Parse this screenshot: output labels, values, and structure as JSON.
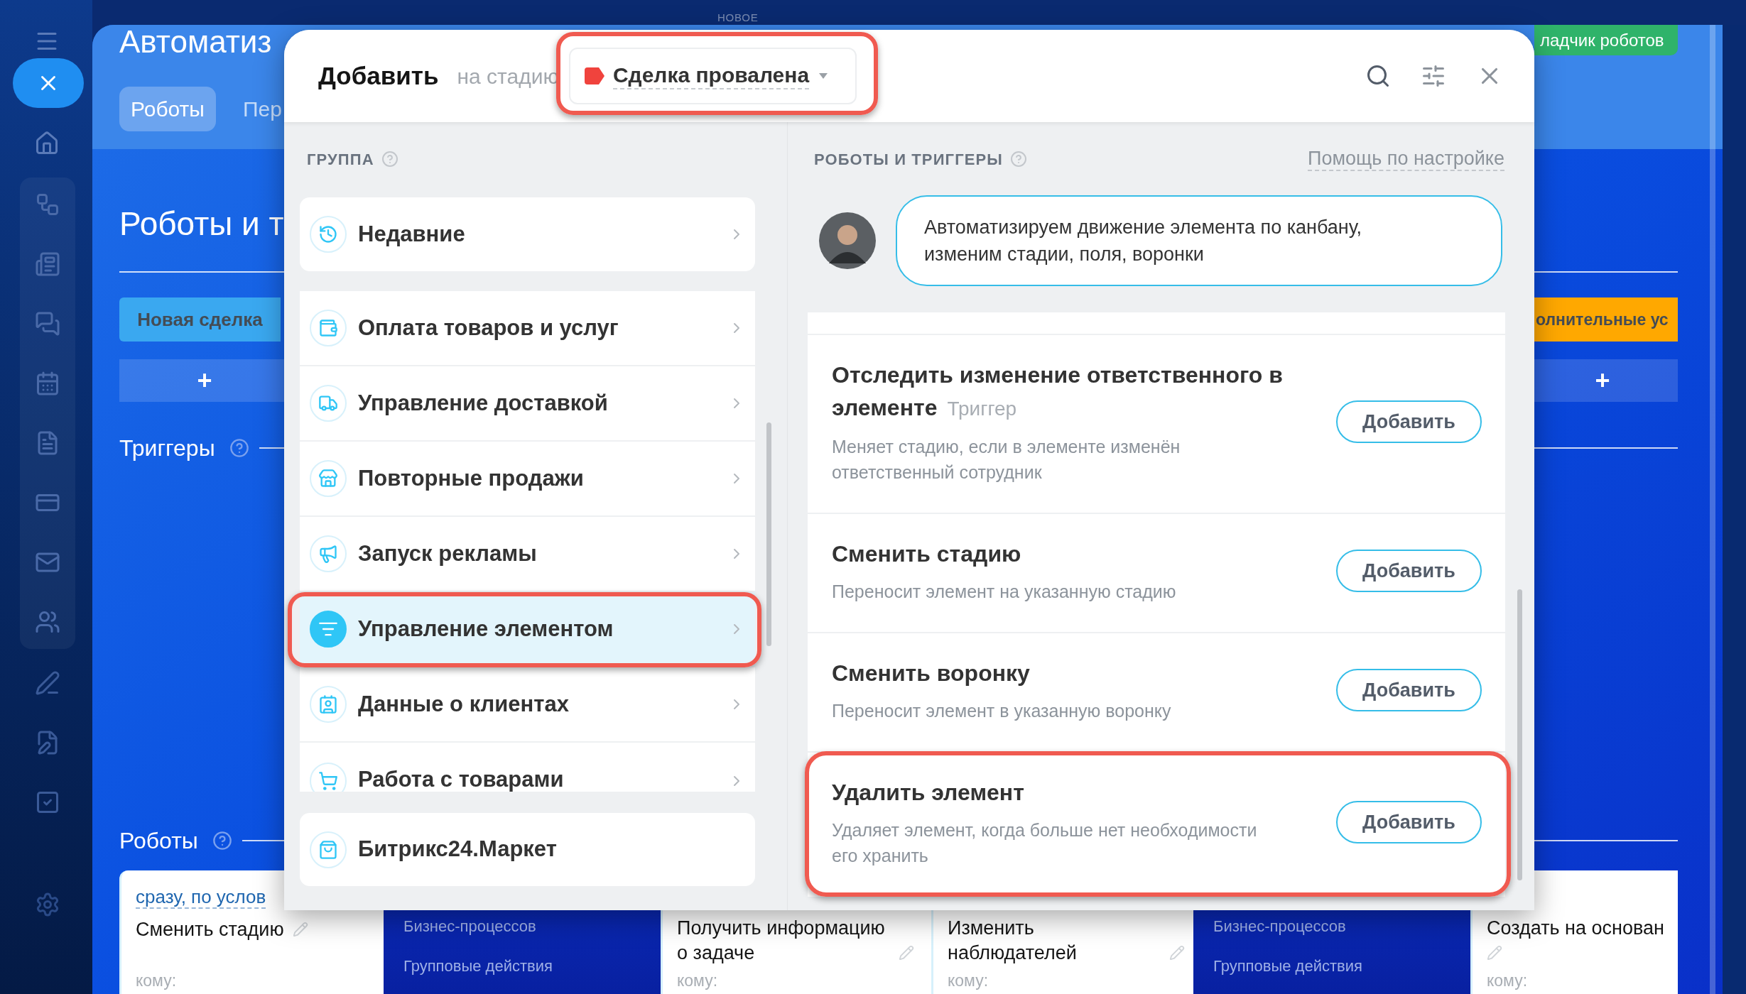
{
  "background": {
    "new_label": "НОВОЕ",
    "page_title": "Автоматиз",
    "tabs": [
      {
        "label": "Роботы",
        "selected": true
      },
      {
        "label": "Пер",
        "selected": false
      }
    ],
    "builder_button": "ладчик роботов",
    "section_title": "Роботы и т",
    "stages": [
      {
        "label": "Новая сделка",
        "color": "#3aa8f0"
      },
      {
        "label": "олнительные ус",
        "color": "#ffa800"
      }
    ],
    "add_buttons": [
      "+",
      "+"
    ],
    "triggers_heading": "Триггеры",
    "robots_heading": "Роботы",
    "robot_cards": [
      {
        "kind": "robot",
        "condition": "сразу, по услов",
        "title": "Сменить стадию",
        "recipient": "кому:"
      },
      {
        "kind": "menu",
        "items": [
          "Бизнес-процессов",
          "Групповые действия"
        ]
      },
      {
        "kind": "robot",
        "title": "Получить информацию о задаче",
        "recipient": "кому:"
      },
      {
        "kind": "robot",
        "title": "Изменить наблюдателей",
        "recipient": "кому:"
      },
      {
        "kind": "menu",
        "items": [
          "Бизнес-процессов",
          "Групповые действия"
        ]
      },
      {
        "kind": "robot",
        "title": "Создать на основан",
        "recipient": "кому:"
      }
    ]
  },
  "dialog": {
    "title": "Добавить",
    "stage_prefix": "на стадию",
    "stage": {
      "label": "Сделка провалена",
      "color": "#f0433d",
      "highlighted": true
    },
    "group_heading": "ГРУППА",
    "recent": {
      "label": "Недавние",
      "selected": false
    },
    "groups": [
      {
        "label": "Оплата товаров и услуг",
        "selected": false,
        "highlighted": false
      },
      {
        "label": "Управление доставкой",
        "selected": false,
        "highlighted": false
      },
      {
        "label": "Повторные продажи",
        "selected": false,
        "highlighted": false
      },
      {
        "label": "Запуск рекламы",
        "selected": false,
        "highlighted": false
      },
      {
        "label": "Управление элементом",
        "selected": true,
        "highlighted": true
      },
      {
        "label": "Данные о клиентах",
        "selected": false,
        "highlighted": false
      },
      {
        "label": "Работа с товарами",
        "selected": false,
        "highlighted": false
      }
    ],
    "market": "Битрикс24.Маркет",
    "robots_heading": "РОБОТЫ И ТРИГГЕРЫ",
    "help_link": "Помощь по настройке",
    "assistant_message": [
      "Автоматизируем движение элемента по канбану,",
      "изменим стадии, поля, воронки"
    ],
    "robots": [
      {
        "title": "Отследить изменение ответственного в элементе",
        "tag": "Триггер",
        "description": "Меняет стадию, если в элементе изменён ответственный сотрудник",
        "button": "Добавить",
        "highlighted": false
      },
      {
        "title": "Сменить стадию",
        "description": "Переносит элемент на указанную стадию",
        "button": "Добавить",
        "highlighted": false
      },
      {
        "title": "Сменить воронку",
        "description": "Переносит элемент в указанную воронку",
        "button": "Добавить",
        "highlighted": false
      },
      {
        "title": "Удалить элемент",
        "description": "Удаляет элемент, когда больше нет необходимости его хранить",
        "button": "Добавить",
        "highlighted": true
      }
    ]
  }
}
